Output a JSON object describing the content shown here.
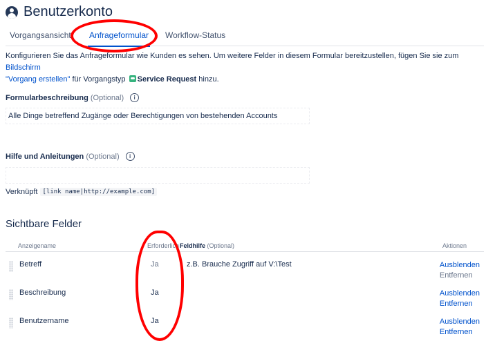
{
  "header": {
    "title": "Benutzerkonto",
    "icon": "user-avatar-icon"
  },
  "tabs": [
    {
      "label": "Vorgangsansicht",
      "active": false
    },
    {
      "label": "Anfrageformular",
      "active": true
    },
    {
      "label": "Workflow-Status",
      "active": false
    }
  ],
  "intro": {
    "text1": "Konfigurieren Sie das Anfrageformular wie Kunden es sehen. Um weitere Felder in diesem Formular bereitzustellen, fügen Sie sie zum ",
    "link1": "Bildschirm",
    "link2": "\"Vorgang erstellen\"",
    "text2": " für Vorgangstyp ",
    "issue_type": "Service Request",
    "text3": " hinzu."
  },
  "form_description": {
    "label": "Formularbeschreibung",
    "optional": "(Optional)",
    "value": "Alle Dinge betreffend Zugänge oder Berechtigungen von bestehenden Accounts"
  },
  "help": {
    "label": "Hilfe und Anleitungen",
    "optional": "(Optional)",
    "value": "",
    "link_hint_label": "Verknüpft",
    "link_hint_code": "[link name|http://example.com]"
  },
  "visible_fields": {
    "title": "Sichtbare Felder",
    "columns": {
      "display_name": "Anzeigename",
      "required": "Erforderlich",
      "field_help": "Feldhilfe",
      "field_help_optional": "(Optional)",
      "actions": "Aktionen"
    },
    "rows": [
      {
        "name": "Betreff",
        "required": "Ja",
        "help": "z.B. Brauche Zugriff auf V:\\Test",
        "action_hide": "Ausblenden",
        "action_remove": "Entfernen",
        "remove_enabled": false
      },
      {
        "name": "Beschreibung",
        "required": "Ja",
        "help": "",
        "action_hide": "Ausblenden",
        "action_remove": "Entfernen",
        "remove_enabled": true
      },
      {
        "name": "Benutzername",
        "required": "Ja",
        "help": "",
        "action_hide": "Ausblenden",
        "action_remove": "Entfernen",
        "remove_enabled": true
      }
    ]
  },
  "colors": {
    "link": "#0052cc",
    "text": "#172b4d",
    "annotation": "#ff0000",
    "issue_type_icon": "#36b37e"
  }
}
